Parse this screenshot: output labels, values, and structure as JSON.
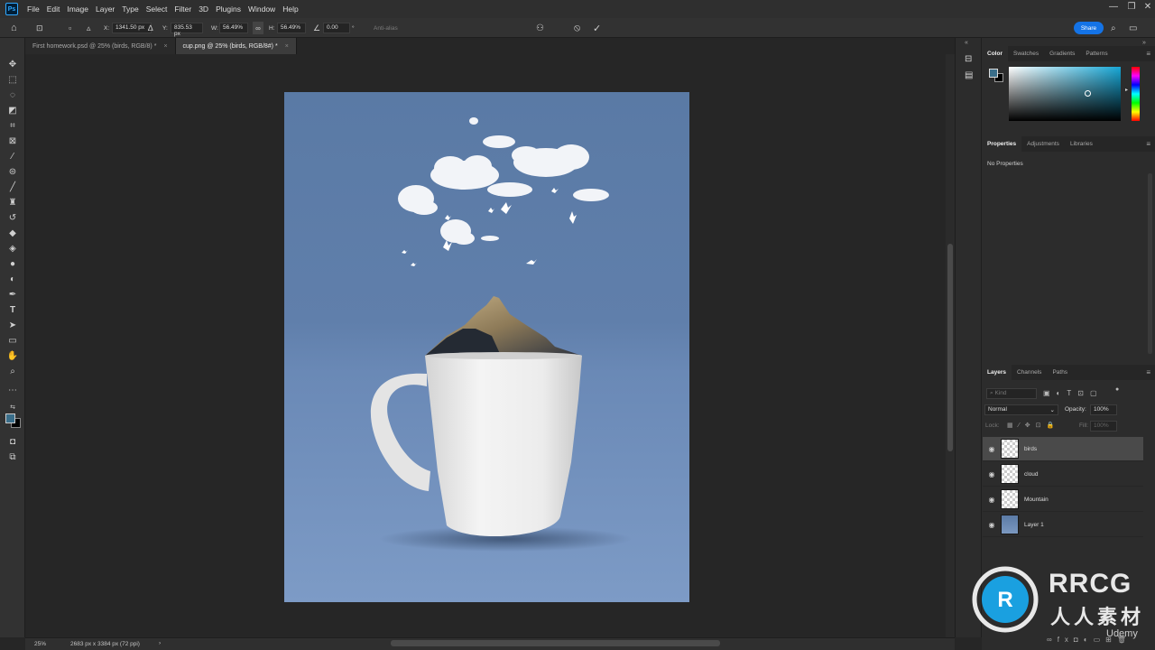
{
  "app": {
    "logo_text": "Ps"
  },
  "menu": [
    "File",
    "Edit",
    "Image",
    "Layer",
    "Type",
    "Select",
    "Filter",
    "3D",
    "Plugins",
    "Window",
    "Help"
  ],
  "window_controls": [
    "—",
    "❐",
    "✕"
  ],
  "options": {
    "x_label": "X:",
    "x_value": "1341.50 px",
    "y_label": "Y:",
    "y_value": "835.53 px",
    "w_label": "W:",
    "w_value": "56.49%",
    "h_label": "H:",
    "h_value": "56.49%",
    "angle_value": "0.00",
    "angle_unit": "°",
    "antialias": "Anti-alias"
  },
  "share_label": "Share",
  "tabs": [
    {
      "label": "First homework.psd @ 25% (birds, RGB/8) *",
      "close": "×"
    },
    {
      "label": "cup.png @ 25% (birds, RGB/8#) *",
      "close": "×"
    }
  ],
  "status": {
    "zoom": "25%",
    "dims": "2683 px x 3384 px (72 ppi)",
    "arrow": "›"
  },
  "color_panel": {
    "tabs": [
      "Color",
      "Swatches",
      "Gradients",
      "Patterns"
    ],
    "fg": "#3a6e8a",
    "bg": "#000000"
  },
  "properties_panel": {
    "tabs": [
      "Properties",
      "Adjustments",
      "Libraries"
    ],
    "empty_text": "No Properties"
  },
  "layers_panel": {
    "tabs": [
      "Layers",
      "Channels",
      "Paths"
    ],
    "filter_placeholder": "Kind",
    "blend_mode": "Normal",
    "opacity_label": "Opacity:",
    "opacity_value": "100%",
    "lock_label": "Lock:",
    "fill_label": "Fill:",
    "fill_value": "100%",
    "layers": [
      {
        "name": "birds",
        "selected": true,
        "thumb": "transparent"
      },
      {
        "name": "cloud",
        "selected": false,
        "thumb": "transparent"
      },
      {
        "name": "Mountain",
        "selected": false,
        "thumb": "transparent"
      },
      {
        "name": "Layer 1",
        "selected": false,
        "thumb": "photo"
      }
    ]
  },
  "watermark": {
    "brand": "RRCG",
    "sub": "人人素材",
    "udemy": "Udemy"
  }
}
